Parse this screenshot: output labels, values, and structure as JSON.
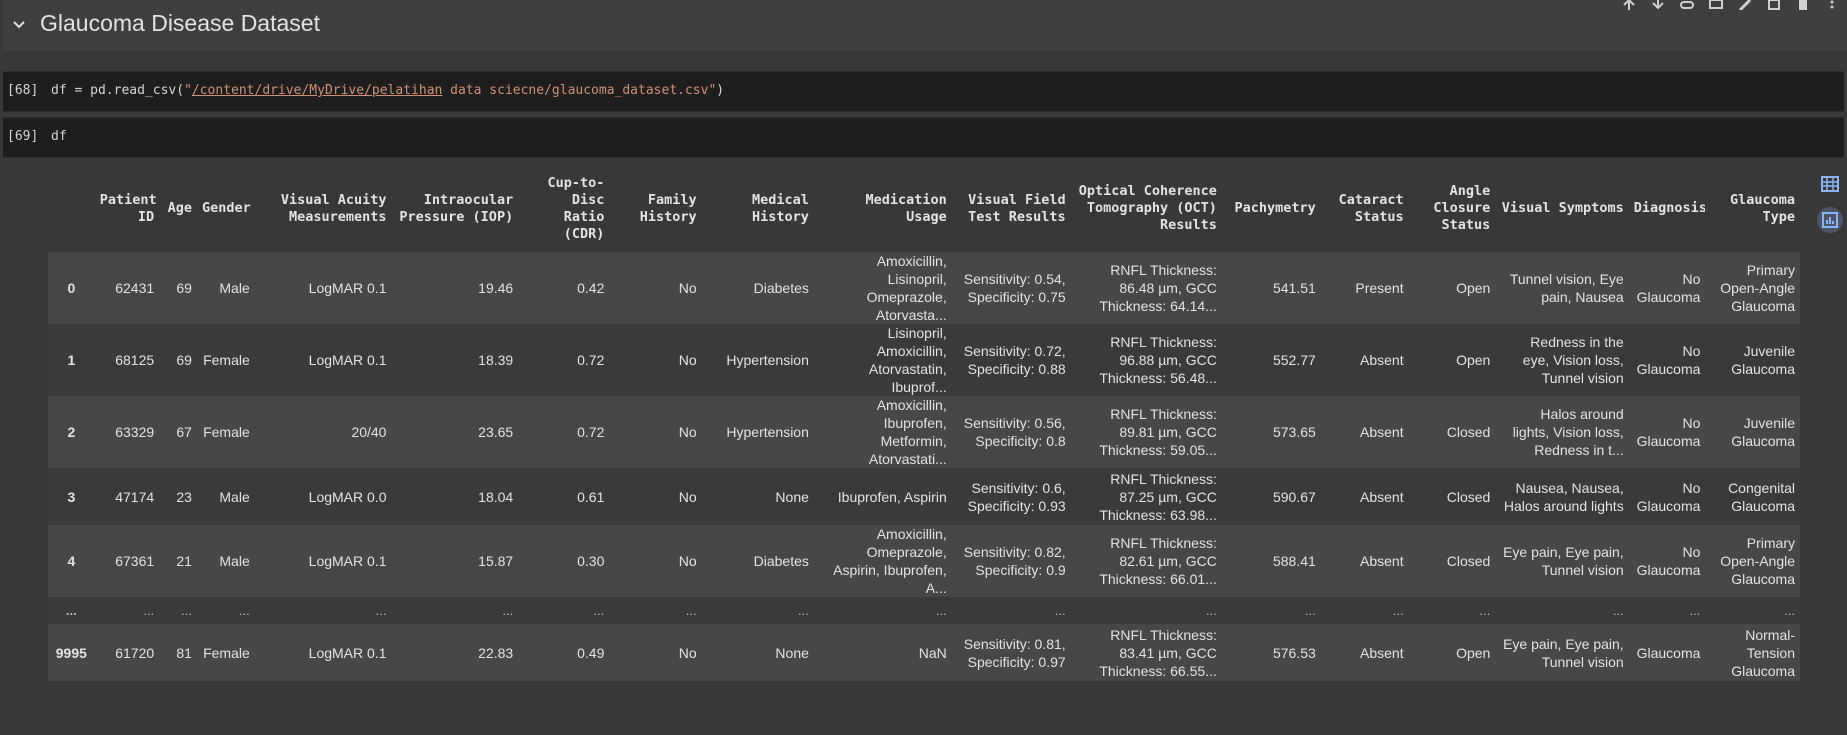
{
  "section": {
    "title": "Glaucoma Disease Dataset"
  },
  "cells": [
    {
      "prompt": "[68]",
      "code_pre": "df = pd.read_csv(",
      "code_q1": "\"",
      "code_path1": "/content/drive/MyDrive/pelatihan",
      "code_mid": " data sciecne/glaucoma_dataset",
      "code_ext": ".csv\"",
      "code_post": ")"
    },
    {
      "prompt": "[69]",
      "code": "df"
    }
  ],
  "icons": {
    "toolbar": [
      "arrow-up-icon",
      "arrow-down-icon",
      "link-icon",
      "comment-icon",
      "edit-icon",
      "mirror-cell-icon",
      "delete-icon",
      "more-vert-icon"
    ],
    "side": [
      "table-view-icon",
      "chart-suggestion-icon"
    ]
  },
  "table": {
    "headers": [
      "",
      "Patient ID",
      "Age",
      "Gender",
      "Visual Acuity Measurements",
      "Intraocular Pressure (IOP)",
      "Cup-to-Disc Ratio (CDR)",
      "Family History",
      "Medical History",
      "Medication Usage",
      "Visual Field Test Results",
      "Optical Coherence Tomography (OCT) Results",
      "Pachymetry",
      "Cataract Status",
      "Angle Closure Status",
      "Visual Symptoms",
      "Diagnosis",
      "Glaucoma Type"
    ],
    "rows": [
      [
        "0",
        "62431",
        "69",
        "Male",
        "LogMAR 0.1",
        "19.46",
        "0.42",
        "No",
        "Diabetes",
        "Amoxicillin, Lisinopril, Omeprazole, Atorvasta...",
        "Sensitivity: 0.54, Specificity: 0.75",
        "RNFL Thickness: 86.48 µm, GCC Thickness: 64.14...",
        "541.51",
        "Present",
        "Open",
        "Tunnel vision, Eye pain, Nausea",
        "No Glaucoma",
        "Primary Open-Angle Glaucoma"
      ],
      [
        "1",
        "68125",
        "69",
        "Female",
        "LogMAR 0.1",
        "18.39",
        "0.72",
        "No",
        "Hypertension",
        "Lisinopril, Amoxicillin, Atorvastatin, Ibuprof...",
        "Sensitivity: 0.72, Specificity: 0.88",
        "RNFL Thickness: 96.88 µm, GCC Thickness: 56.48...",
        "552.77",
        "Absent",
        "Open",
        "Redness in the eye, Vision loss, Tunnel vision",
        "No Glaucoma",
        "Juvenile Glaucoma"
      ],
      [
        "2",
        "63329",
        "67",
        "Female",
        "20/40",
        "23.65",
        "0.72",
        "No",
        "Hypertension",
        "Amoxicillin, Ibuprofen, Metformin, Atorvastati...",
        "Sensitivity: 0.56, Specificity: 0.8",
        "RNFL Thickness: 89.81 µm, GCC Thickness: 59.05...",
        "573.65",
        "Absent",
        "Closed",
        "Halos around lights, Vision loss, Redness in t...",
        "No Glaucoma",
        "Juvenile Glaucoma"
      ],
      [
        "3",
        "47174",
        "23",
        "Male",
        "LogMAR 0.0",
        "18.04",
        "0.61",
        "No",
        "None",
        "Ibuprofen, Aspirin",
        "Sensitivity: 0.6, Specificity: 0.93",
        "RNFL Thickness: 87.25 µm, GCC Thickness: 63.98...",
        "590.67",
        "Absent",
        "Closed",
        "Nausea, Nausea, Halos around lights",
        "No Glaucoma",
        "Congenital Glaucoma"
      ],
      [
        "4",
        "67361",
        "21",
        "Male",
        "LogMAR 0.1",
        "15.87",
        "0.30",
        "No",
        "Diabetes",
        "Amoxicillin, Omeprazole, Aspirin, Ibuprofen, A...",
        "Sensitivity: 0.82, Specificity: 0.9",
        "RNFL Thickness: 82.61 µm, GCC Thickness: 66.01...",
        "588.41",
        "Absent",
        "Closed",
        "Eye pain, Eye pain, Tunnel vision",
        "No Glaucoma",
        "Primary Open-Angle Glaucoma"
      ],
      [
        "...",
        "...",
        "...",
        "...",
        "...",
        "...",
        "...",
        "...",
        "...",
        "...",
        "...",
        "...",
        "...",
        "...",
        "...",
        "...",
        "...",
        "..."
      ],
      [
        "9995",
        "61720",
        "81",
        "Female",
        "LogMAR 0.1",
        "22.83",
        "0.49",
        "No",
        "None",
        "NaN",
        "Sensitivity: 0.81, Specificity: 0.97",
        "RNFL Thickness: 83.41 µm, GCC Thickness: 66.55...",
        "576.53",
        "Absent",
        "Open",
        "Eye pain, Eye pain, Tunnel vision",
        "Glaucoma",
        "Normal-Tension Glaucoma"
      ]
    ]
  }
}
